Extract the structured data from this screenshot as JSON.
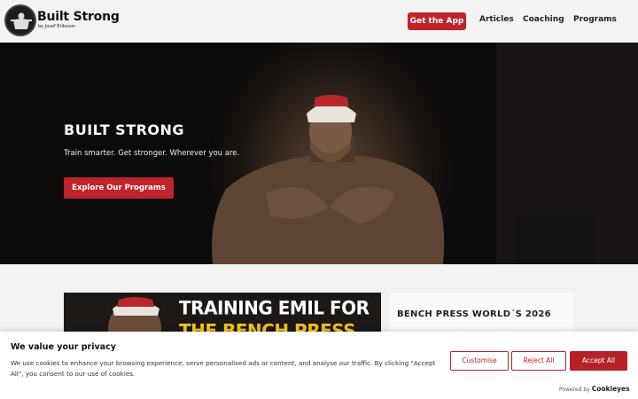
{
  "header": {
    "logo_title": "Built Strong",
    "logo_sub": "by Josef Eriksson",
    "app_button": "Get the App",
    "nav": [
      "Articles",
      "Coaching",
      "Programs"
    ]
  },
  "hero": {
    "title": "BUILT STRONG",
    "subtitle": "Train smarter. Get stronger. Wherever you are.",
    "cta": "Explore Our Programs"
  },
  "feature": {
    "thumb_line1": "TRAINING EMIL FOR",
    "thumb_line2": "THE BENCH PRESS",
    "side_title": "BENCH PRESS WORLD´S 2026"
  },
  "cookie": {
    "title": "We value your privacy",
    "text": "We use cookies to enhance your browsing experience, serve personalised ads or content, and analyse our traffic. By clicking \"Accept All\", you consent to our use of cookies.",
    "customise": "Customise",
    "reject": "Reject All",
    "accept": "Accept All",
    "powered_by": "Powered by",
    "brand": "Cookieyes"
  },
  "colors": {
    "accent": "#c0232a",
    "background": "#f2f2f2"
  }
}
